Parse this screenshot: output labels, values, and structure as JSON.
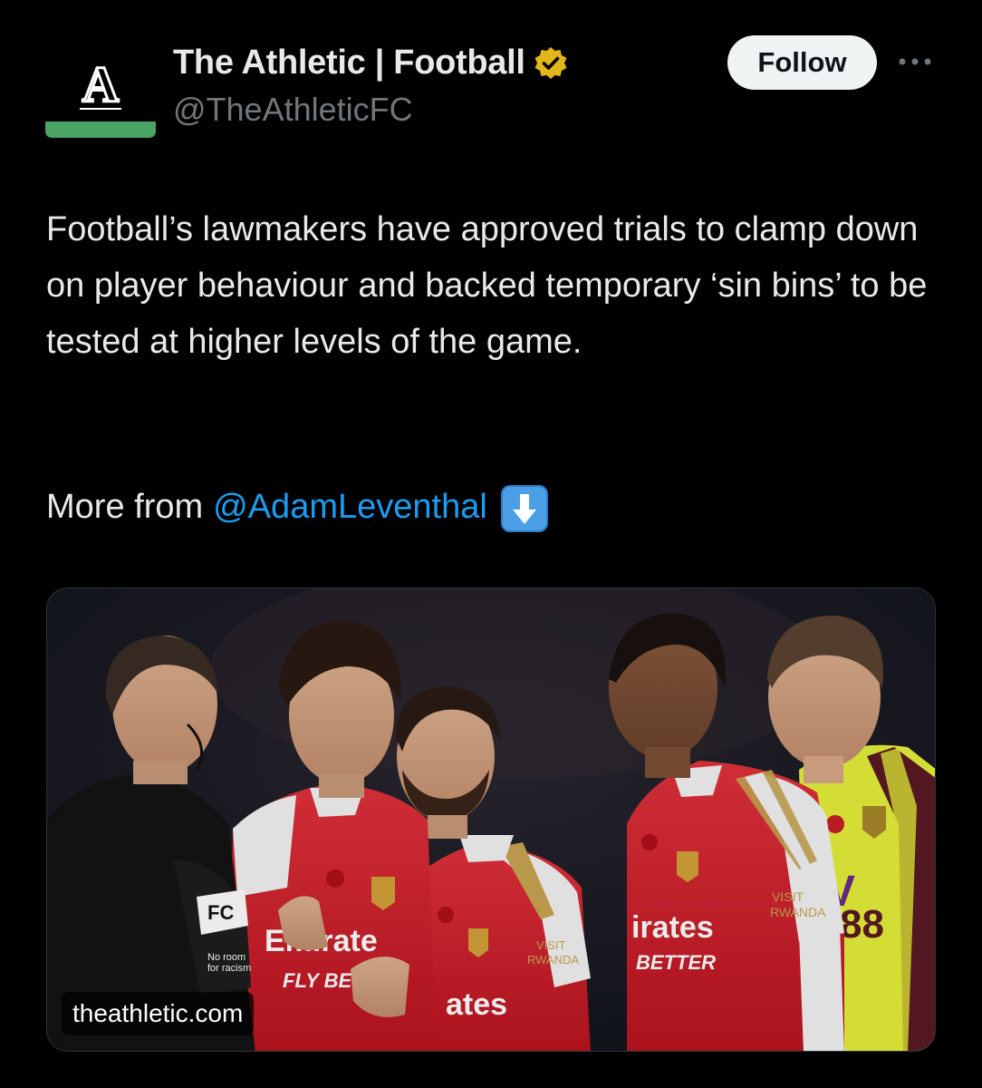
{
  "tweet": {
    "author": {
      "display_name": "The Athletic | Football",
      "handle": "@TheAthleticFC",
      "avatar_letter": "A",
      "verified": true,
      "verified_color": "#e2b719",
      "avatar_accent": "#4aa564"
    },
    "follow_label": "Follow",
    "body": "Football’s lawmakers have approved trials to clamp down on player behaviour and backed temporary ‘sin bins’ to be tested at higher levels of the game.",
    "more_prefix": "More from",
    "more_mention": "@AdamLeventhal",
    "more_emoji": "down-arrow-emoji",
    "media": {
      "link_domain": "theathletic.com",
      "photo_text": {
        "shirt_sponsor_1": "Fly Better",
        "shirt_sponsor_2": "Emirates",
        "sleeve_1": "Visit Rwanda",
        "referee_sleeve": "No room for racism",
        "referee_badge": "EA Sports FC",
        "yellow_shirt_number": "88"
      }
    }
  },
  "colors": {
    "background": "#000000",
    "text": "#e7e9ea",
    "secondary": "#71767b",
    "link": "#1d9bf0",
    "follow_bg": "#eff3f4",
    "arsenal_red": "#d81e2c",
    "burnley_yellow": "#e6f03a"
  }
}
